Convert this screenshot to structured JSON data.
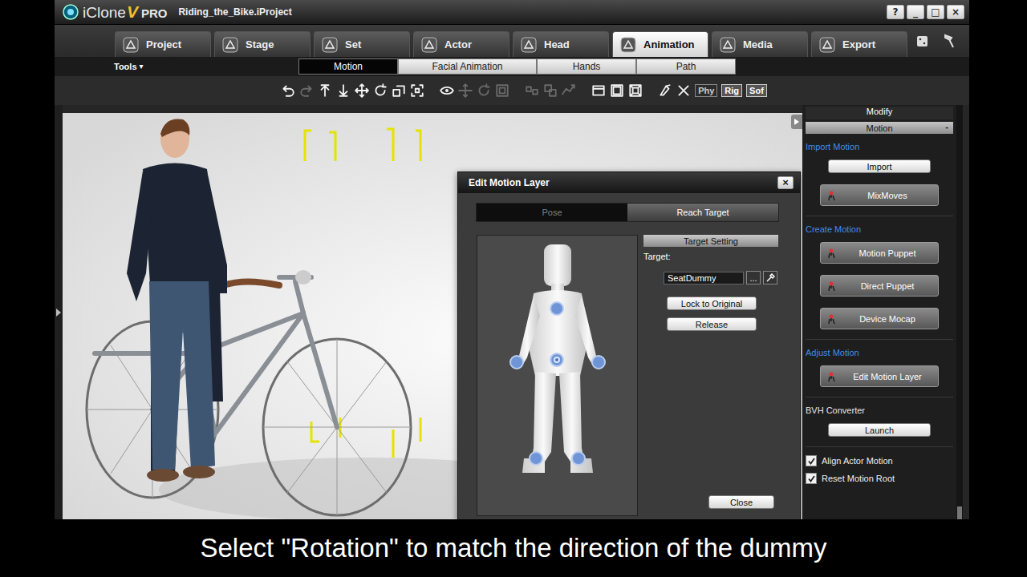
{
  "window": {
    "logo": "iClone",
    "logo_version": "V",
    "logo_edition": "PRO",
    "title": "Riding_the_Bike.iProject",
    "controls": [
      "?",
      "_",
      "□",
      "×"
    ]
  },
  "tabs": [
    {
      "label": "Project",
      "selected": false
    },
    {
      "label": "Stage",
      "selected": false
    },
    {
      "label": "Set",
      "selected": false
    },
    {
      "label": "Actor",
      "selected": false
    },
    {
      "label": "Head",
      "selected": false
    },
    {
      "label": "Animation",
      "selected": true
    },
    {
      "label": "Media",
      "selected": false
    },
    {
      "label": "Export",
      "selected": false
    }
  ],
  "tools_menu": {
    "label": "Tools",
    "arrow": "▾"
  },
  "sub_tabs": [
    {
      "label": "Motion",
      "selected": true
    },
    {
      "label": "Facial Animation",
      "selected": false
    },
    {
      "label": "Hands",
      "selected": false
    },
    {
      "label": "Path",
      "selected": false
    }
  ],
  "toolbar": {
    "tools": [
      {
        "disabled": false
      },
      {
        "disabled": true
      },
      {
        "disabled": false
      },
      {
        "disabled": false
      },
      {
        "disabled": false
      },
      {
        "disabled": false
      },
      {
        "disabled": false
      },
      {
        "disabled": false
      },
      {
        "disabled": false
      },
      {
        "disabled": true
      },
      {
        "disabled": true
      },
      {
        "disabled": true
      },
      {
        "disabled": true
      },
      {
        "disabled": true
      },
      {
        "disabled": true
      },
      {
        "disabled": false
      },
      {
        "disabled": false
      },
      {
        "disabled": false
      },
      {
        "disabled": false
      },
      {
        "disabled": false
      }
    ],
    "labels": [
      "Phy",
      "Rig",
      "Sof"
    ]
  },
  "dialog": {
    "title": "Edit Motion Layer",
    "close": "×",
    "tabs": [
      {
        "label": "Pose",
        "selected": false
      },
      {
        "label": "Reach Target",
        "selected": true
      }
    ],
    "effectors": [
      {
        "selected": false
      },
      {
        "selected": true
      },
      {
        "selected": false
      },
      {
        "selected": false
      },
      {
        "selected": false
      },
      {
        "selected": false
      }
    ],
    "section": "Target Setting",
    "target_label": "Target:",
    "target_value": "SeatDummy",
    "browse": "...",
    "buttons": [
      "Lock to Original",
      "Release"
    ],
    "close_button": "Close"
  },
  "panel": {
    "title": "Modify",
    "section": {
      "label": "Motion",
      "toggle": "-"
    },
    "groups": [
      {
        "heading": "Import Motion",
        "kind": "link",
        "buttons": [
          {
            "label": "Import",
            "kind": "flat"
          },
          {
            "label": "MixMoves",
            "kind": "icon"
          }
        ]
      },
      {
        "heading": "Create Motion",
        "kind": "link",
        "buttons": [
          {
            "label": "Motion Puppet",
            "kind": "icon"
          },
          {
            "label": "Direct Puppet",
            "kind": "icon"
          },
          {
            "label": "Device Mocap",
            "kind": "icon"
          }
        ]
      },
      {
        "heading": "Adjust Motion",
        "kind": "link",
        "buttons": [
          {
            "label": "Edit Motion Layer",
            "kind": "icon"
          }
        ]
      },
      {
        "heading": "BVH Converter",
        "kind": "plain",
        "buttons": [
          {
            "label": "Launch",
            "kind": "flat"
          }
        ]
      }
    ],
    "options": [
      {
        "label": "Align Actor Motion",
        "checked": true
      },
      {
        "label": "Reset Motion Root",
        "checked": true
      }
    ]
  },
  "caption": "Select \"Rotation\" to match the direction of the dummy"
}
